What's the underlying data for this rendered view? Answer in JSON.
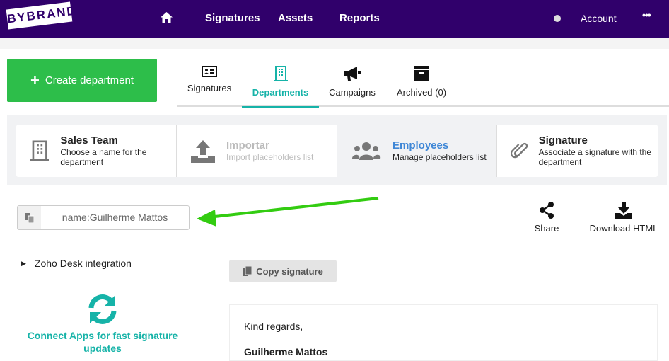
{
  "nav": {
    "logo": "BYBRAND",
    "items": [
      "Signatures",
      "Assets",
      "Reports"
    ],
    "account": "Account",
    "home_icon": "home-icon",
    "more_icon": "more-icon"
  },
  "create_button": "Create department",
  "tabs": [
    {
      "label": "Signatures",
      "icon": "id-card-icon"
    },
    {
      "label": "Departments",
      "icon": "building-icon",
      "active": true
    },
    {
      "label": "Campaigns",
      "icon": "megaphone-icon"
    },
    {
      "label": "Archived (0)",
      "icon": "archive-icon"
    }
  ],
  "steps": [
    {
      "title": "Sales Team",
      "desc": "Choose a name for the department",
      "icon": "building-icon"
    },
    {
      "title": "Importar",
      "desc": "Import placeholders list",
      "icon": "upload-icon",
      "disabled": true
    },
    {
      "title": "Employees",
      "desc": "Manage placeholders list",
      "icon": "users-icon",
      "active": true
    },
    {
      "title": "Signature",
      "desc": "Associate a signature with the department",
      "icon": "paperclip-icon"
    }
  ],
  "placeholder_field": {
    "value": "name:Guilherme Mattos"
  },
  "actions": {
    "share": "Share",
    "download": "Download HTML"
  },
  "zoho": "Zoho Desk integration",
  "copy_signature": "Copy signature",
  "connect": "Connect Apps for fast signature updates",
  "signature": {
    "greeting": "Kind regards,",
    "name": "Guilherme Mattos"
  },
  "colors": {
    "nav": "#30006b",
    "accent": "#16b3a8",
    "green": "#2dbe4a",
    "arrow": "#33cc11"
  }
}
